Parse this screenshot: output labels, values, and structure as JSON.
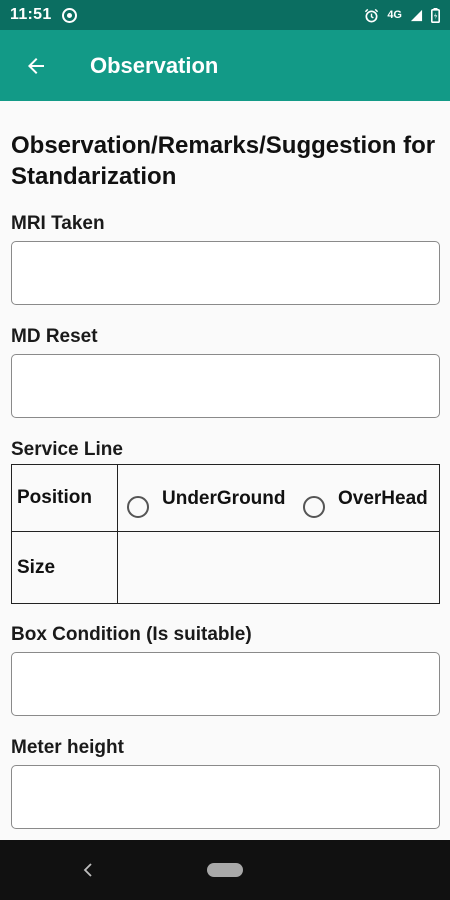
{
  "status_bar": {
    "time": "11:51",
    "network": "4G"
  },
  "app_bar": {
    "title": "Observation"
  },
  "form": {
    "section_title": "Observation/Remarks/Suggestion for Standarization",
    "mri_taken_label": "MRI Taken",
    "mri_taken_value": "",
    "md_reset_label": "MD Reset",
    "md_reset_value": "",
    "service_line_label": "Service Line",
    "service_line": {
      "position_label": "Position",
      "options": [
        "UnderGround",
        "OverHead"
      ],
      "selected": null,
      "size_label": "Size"
    },
    "box_condition_label": "Box Condition (Is suitable)",
    "box_condition_value": "",
    "meter_height_label": "Meter height",
    "meter_height_value": ""
  },
  "colors": {
    "status_bar": "#0b6e61",
    "app_bar": "#129a87",
    "nav_bar": "#111111"
  },
  "icons": {
    "back": "arrow-back-icon",
    "alarm": "alarm-icon",
    "signal": "signal-icon",
    "battery": "battery-icon"
  }
}
